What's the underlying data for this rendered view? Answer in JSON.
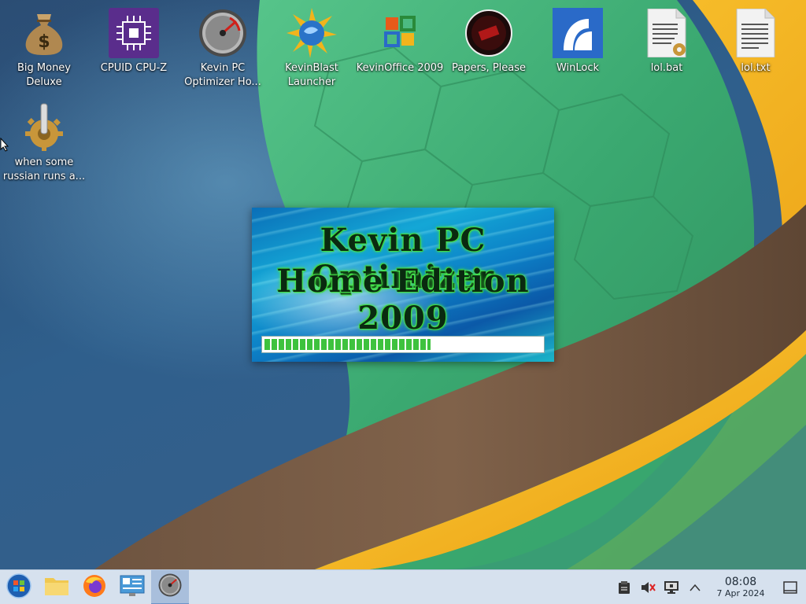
{
  "desktop": {
    "icons": [
      {
        "label": "Big Money Deluxe",
        "icon": "money-bag-icon"
      },
      {
        "label": "CPUID CPU-Z",
        "icon": "cpu-chip-icon"
      },
      {
        "label": "Kevin PC Optimizer Ho...",
        "icon": "speedometer-icon"
      },
      {
        "label": "KevinBlast Launcher",
        "icon": "globe-burst-icon"
      },
      {
        "label": "KevinOffice 2009",
        "icon": "office-logo-icon"
      },
      {
        "label": "Papers, Please",
        "icon": "papers-please-icon"
      },
      {
        "label": "WinLock",
        "icon": "winlock-icon"
      },
      {
        "label": "lol.bat",
        "icon": "batch-file-icon"
      },
      {
        "label": "lol.txt",
        "icon": "text-file-icon"
      },
      {
        "label": "when some russian runs a...",
        "icon": "gear-lever-icon"
      }
    ]
  },
  "splash": {
    "title_line1": "Kevin PC Optimizer",
    "title_line2": "Home Edition 2009",
    "progress_fraction": 0.6
  },
  "taskbar": {
    "buttons": [
      {
        "name": "start-button",
        "icon": "windows-orb-icon"
      },
      {
        "name": "file-manager-button",
        "icon": "folder-icon"
      },
      {
        "name": "firefox-button",
        "icon": "firefox-icon"
      },
      {
        "name": "control-panel-button",
        "icon": "control-panel-icon"
      },
      {
        "name": "kevin-optimizer-task",
        "icon": "speedometer-icon",
        "active": true
      }
    ],
    "tray": {
      "clipboard_icon": "clipboard-icon",
      "volume_icon": "volume-muted-icon",
      "display_icon": "display-icon",
      "expand_icon": "chevron-up-icon",
      "time": "08:08",
      "date": "7 Apr 2024",
      "show_desktop_icon": "show-desktop-icon"
    }
  },
  "colors": {
    "taskbar": "#d6e1ee",
    "wallpaper_green": "#3aa870",
    "wallpaper_gold": "#f2b41c",
    "wallpaper_brown": "#7a5a40",
    "progress_green": "#3ec23e"
  }
}
